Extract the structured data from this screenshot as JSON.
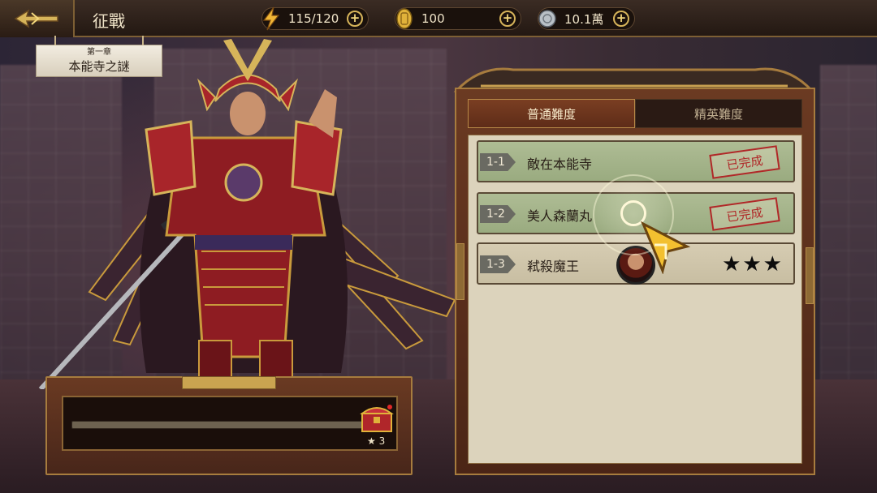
{
  "header": {
    "title": "征戰",
    "stamina": "115/120",
    "gold": "100",
    "silver": "10.1萬"
  },
  "chapter": {
    "number": "第一章",
    "name": "本能寺之謎"
  },
  "tabs": [
    {
      "label": "普通難度",
      "active": true
    },
    {
      "label": "精英難度",
      "active": false
    }
  ],
  "stages": [
    {
      "id": "1-1",
      "name": "敵在本能寺",
      "status": "已完成"
    },
    {
      "id": "1-2",
      "name": "美人森蘭丸",
      "status": "已完成"
    },
    {
      "id": "1-3",
      "name": "弒殺魔王",
      "stars": "★★★"
    }
  ],
  "progress": {
    "chest_stars": "3",
    "fill": 0
  },
  "colors": {
    "accent_gold": "#d6b45a",
    "stamp_red": "#b02828",
    "panel_brown": "#6b3a22"
  },
  "icons": [
    "back-arrow-icon",
    "lightning-icon",
    "gold-coin-icon",
    "silver-coin-icon",
    "plus-icon",
    "treasure-chest-icon",
    "star-icon"
  ]
}
